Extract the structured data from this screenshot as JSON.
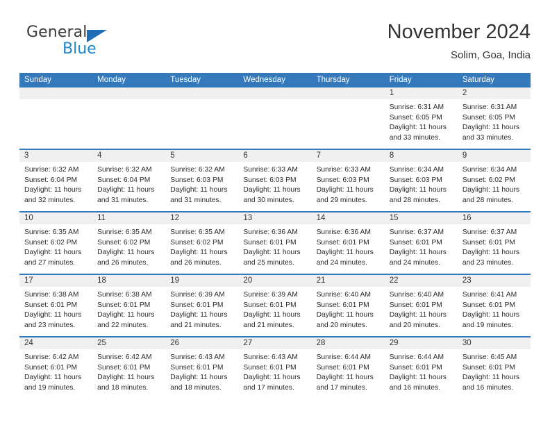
{
  "brand": {
    "name_top": "General",
    "name_bottom": "Blue",
    "triangle_color": "#1f6fb8",
    "blue_color": "#1f86d0"
  },
  "header": {
    "month_title": "November 2024",
    "location": "Solim, Goa, India"
  },
  "theme": {
    "header_blue": "#3479bc",
    "daynum_band": "#f0f0f0"
  },
  "weekdays": [
    "Sunday",
    "Monday",
    "Tuesday",
    "Wednesday",
    "Thursday",
    "Friday",
    "Saturday"
  ],
  "weeks": [
    [
      {
        "day": "",
        "sunrise": "",
        "sunset": "",
        "daylight": ""
      },
      {
        "day": "",
        "sunrise": "",
        "sunset": "",
        "daylight": ""
      },
      {
        "day": "",
        "sunrise": "",
        "sunset": "",
        "daylight": ""
      },
      {
        "day": "",
        "sunrise": "",
        "sunset": "",
        "daylight": ""
      },
      {
        "day": "",
        "sunrise": "",
        "sunset": "",
        "daylight": ""
      },
      {
        "day": "1",
        "sunrise": "Sunrise: 6:31 AM",
        "sunset": "Sunset: 6:05 PM",
        "daylight": "Daylight: 11 hours and 33 minutes."
      },
      {
        "day": "2",
        "sunrise": "Sunrise: 6:31 AM",
        "sunset": "Sunset: 6:05 PM",
        "daylight": "Daylight: 11 hours and 33 minutes."
      }
    ],
    [
      {
        "day": "3",
        "sunrise": "Sunrise: 6:32 AM",
        "sunset": "Sunset: 6:04 PM",
        "daylight": "Daylight: 11 hours and 32 minutes."
      },
      {
        "day": "4",
        "sunrise": "Sunrise: 6:32 AM",
        "sunset": "Sunset: 6:04 PM",
        "daylight": "Daylight: 11 hours and 31 minutes."
      },
      {
        "day": "5",
        "sunrise": "Sunrise: 6:32 AM",
        "sunset": "Sunset: 6:03 PM",
        "daylight": "Daylight: 11 hours and 31 minutes."
      },
      {
        "day": "6",
        "sunrise": "Sunrise: 6:33 AM",
        "sunset": "Sunset: 6:03 PM",
        "daylight": "Daylight: 11 hours and 30 minutes."
      },
      {
        "day": "7",
        "sunrise": "Sunrise: 6:33 AM",
        "sunset": "Sunset: 6:03 PM",
        "daylight": "Daylight: 11 hours and 29 minutes."
      },
      {
        "day": "8",
        "sunrise": "Sunrise: 6:34 AM",
        "sunset": "Sunset: 6:03 PM",
        "daylight": "Daylight: 11 hours and 28 minutes."
      },
      {
        "day": "9",
        "sunrise": "Sunrise: 6:34 AM",
        "sunset": "Sunset: 6:02 PM",
        "daylight": "Daylight: 11 hours and 28 minutes."
      }
    ],
    [
      {
        "day": "10",
        "sunrise": "Sunrise: 6:35 AM",
        "sunset": "Sunset: 6:02 PM",
        "daylight": "Daylight: 11 hours and 27 minutes."
      },
      {
        "day": "11",
        "sunrise": "Sunrise: 6:35 AM",
        "sunset": "Sunset: 6:02 PM",
        "daylight": "Daylight: 11 hours and 26 minutes."
      },
      {
        "day": "12",
        "sunrise": "Sunrise: 6:35 AM",
        "sunset": "Sunset: 6:02 PM",
        "daylight": "Daylight: 11 hours and 26 minutes."
      },
      {
        "day": "13",
        "sunrise": "Sunrise: 6:36 AM",
        "sunset": "Sunset: 6:01 PM",
        "daylight": "Daylight: 11 hours and 25 minutes."
      },
      {
        "day": "14",
        "sunrise": "Sunrise: 6:36 AM",
        "sunset": "Sunset: 6:01 PM",
        "daylight": "Daylight: 11 hours and 24 minutes."
      },
      {
        "day": "15",
        "sunrise": "Sunrise: 6:37 AM",
        "sunset": "Sunset: 6:01 PM",
        "daylight": "Daylight: 11 hours and 24 minutes."
      },
      {
        "day": "16",
        "sunrise": "Sunrise: 6:37 AM",
        "sunset": "Sunset: 6:01 PM",
        "daylight": "Daylight: 11 hours and 23 minutes."
      }
    ],
    [
      {
        "day": "17",
        "sunrise": "Sunrise: 6:38 AM",
        "sunset": "Sunset: 6:01 PM",
        "daylight": "Daylight: 11 hours and 23 minutes."
      },
      {
        "day": "18",
        "sunrise": "Sunrise: 6:38 AM",
        "sunset": "Sunset: 6:01 PM",
        "daylight": "Daylight: 11 hours and 22 minutes."
      },
      {
        "day": "19",
        "sunrise": "Sunrise: 6:39 AM",
        "sunset": "Sunset: 6:01 PM",
        "daylight": "Daylight: 11 hours and 21 minutes."
      },
      {
        "day": "20",
        "sunrise": "Sunrise: 6:39 AM",
        "sunset": "Sunset: 6:01 PM",
        "daylight": "Daylight: 11 hours and 21 minutes."
      },
      {
        "day": "21",
        "sunrise": "Sunrise: 6:40 AM",
        "sunset": "Sunset: 6:01 PM",
        "daylight": "Daylight: 11 hours and 20 minutes."
      },
      {
        "day": "22",
        "sunrise": "Sunrise: 6:40 AM",
        "sunset": "Sunset: 6:01 PM",
        "daylight": "Daylight: 11 hours and 20 minutes."
      },
      {
        "day": "23",
        "sunrise": "Sunrise: 6:41 AM",
        "sunset": "Sunset: 6:01 PM",
        "daylight": "Daylight: 11 hours and 19 minutes."
      }
    ],
    [
      {
        "day": "24",
        "sunrise": "Sunrise: 6:42 AM",
        "sunset": "Sunset: 6:01 PM",
        "daylight": "Daylight: 11 hours and 19 minutes."
      },
      {
        "day": "25",
        "sunrise": "Sunrise: 6:42 AM",
        "sunset": "Sunset: 6:01 PM",
        "daylight": "Daylight: 11 hours and 18 minutes."
      },
      {
        "day": "26",
        "sunrise": "Sunrise: 6:43 AM",
        "sunset": "Sunset: 6:01 PM",
        "daylight": "Daylight: 11 hours and 18 minutes."
      },
      {
        "day": "27",
        "sunrise": "Sunrise: 6:43 AM",
        "sunset": "Sunset: 6:01 PM",
        "daylight": "Daylight: 11 hours and 17 minutes."
      },
      {
        "day": "28",
        "sunrise": "Sunrise: 6:44 AM",
        "sunset": "Sunset: 6:01 PM",
        "daylight": "Daylight: 11 hours and 17 minutes."
      },
      {
        "day": "29",
        "sunrise": "Sunrise: 6:44 AM",
        "sunset": "Sunset: 6:01 PM",
        "daylight": "Daylight: 11 hours and 16 minutes."
      },
      {
        "day": "30",
        "sunrise": "Sunrise: 6:45 AM",
        "sunset": "Sunset: 6:01 PM",
        "daylight": "Daylight: 11 hours and 16 minutes."
      }
    ]
  ]
}
